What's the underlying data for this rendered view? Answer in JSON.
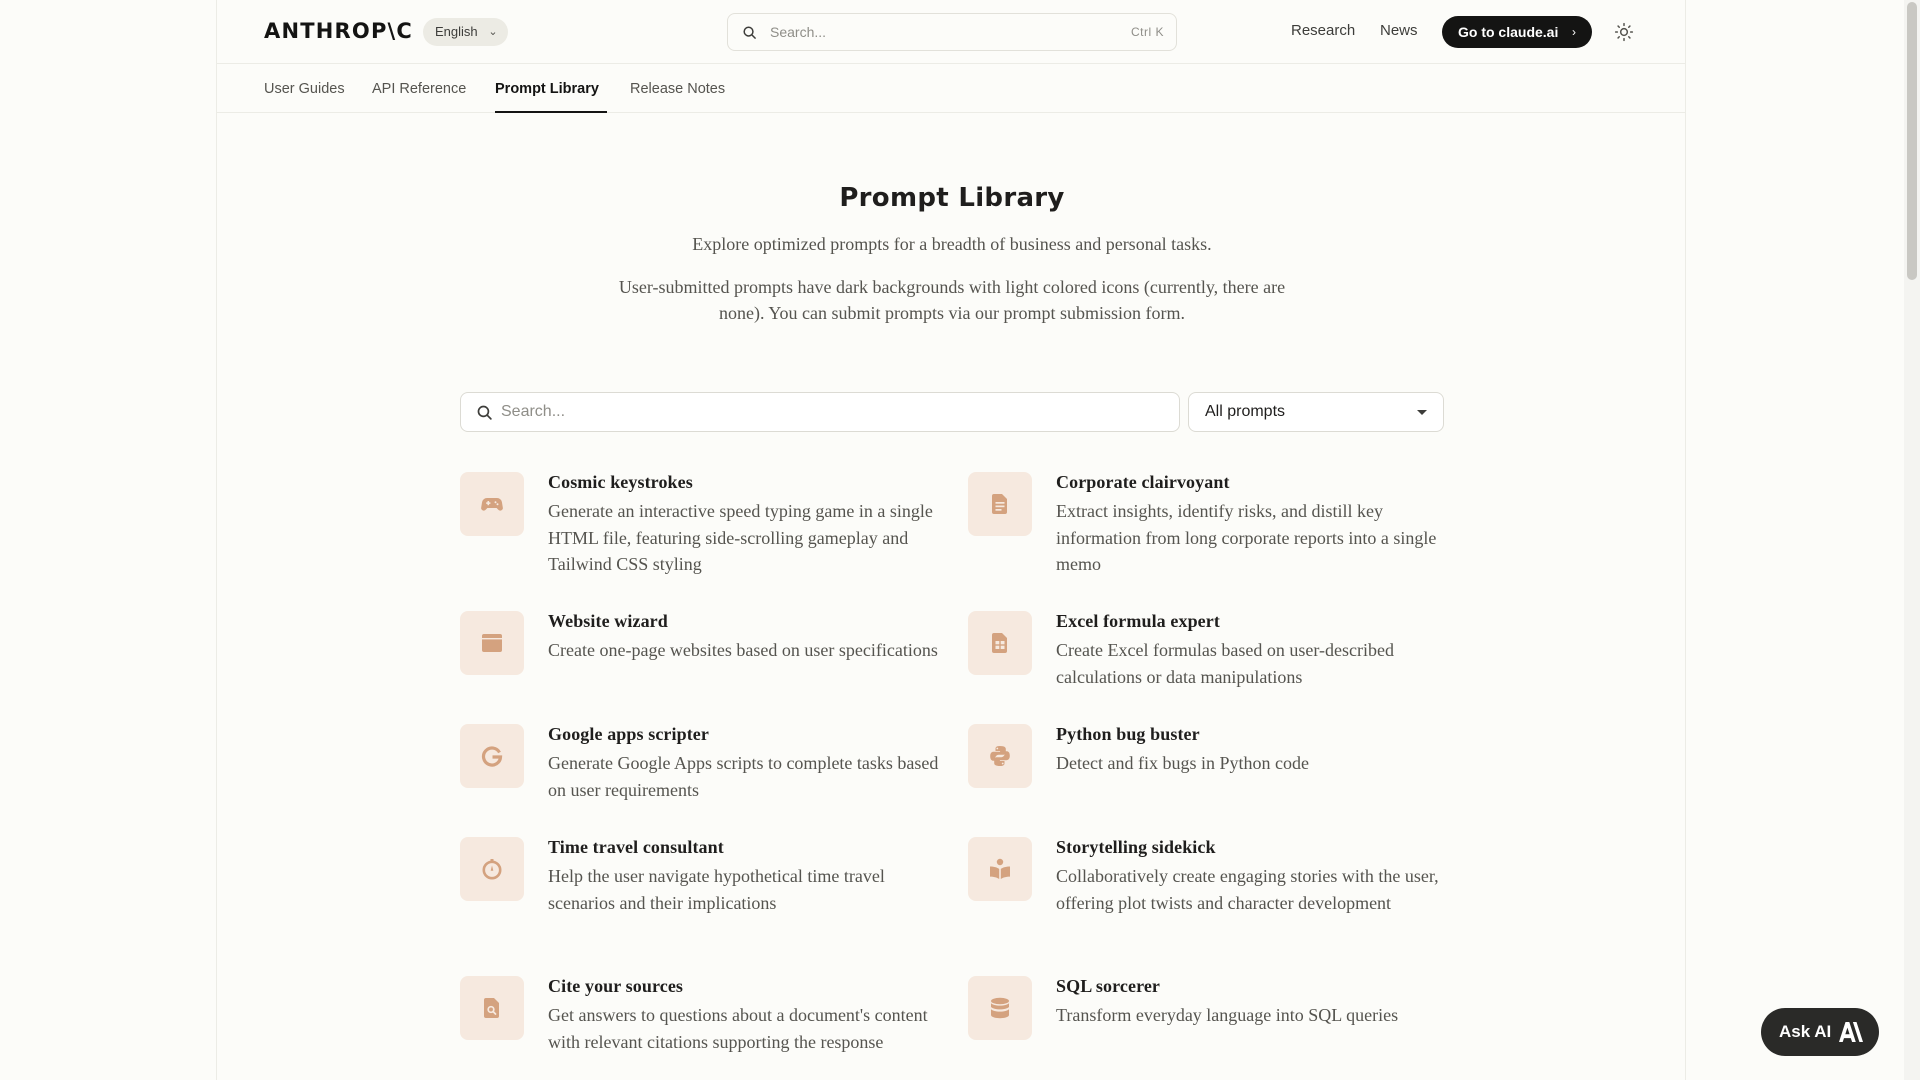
{
  "header": {
    "logo": "ANTHROP\\C",
    "language": "English",
    "search_placeholder": "Search...",
    "search_shortcut": "Ctrl K",
    "nav": [
      "Research",
      "News"
    ],
    "cta_label": "Go to claude.ai"
  },
  "tabs": [
    {
      "label": "User Guides",
      "active": false
    },
    {
      "label": "API Reference",
      "active": false
    },
    {
      "label": "Prompt Library",
      "active": true
    },
    {
      "label": "Release Notes",
      "active": false
    }
  ],
  "hero": {
    "title": "Prompt Library",
    "subtitle": "Explore optimized prompts for a breadth of business and personal tasks.",
    "note_line1": "User-submitted prompts have dark backgrounds with light colored icons (currently, there are",
    "note_line2": "none). You can submit prompts via our prompt submission form."
  },
  "filters": {
    "search_placeholder": "Search...",
    "select_value": "All prompts"
  },
  "cards": [
    {
      "icon": "gamepad-icon",
      "title": "Cosmic keystrokes",
      "desc": "Generate an interactive speed typing game in a single HTML file, featuring side-scrolling gameplay and Tailwind CSS styling"
    },
    {
      "icon": "document-icon",
      "title": "Corporate clairvoyant",
      "desc": "Extract insights, identify risks, and distill key information from long corporate reports into a single memo"
    },
    {
      "icon": "browser-window-icon",
      "title": "Website wizard",
      "desc": "Create one-page websites based on user specifications"
    },
    {
      "icon": "spreadsheet-icon",
      "title": "Excel formula expert",
      "desc": "Create Excel formulas based on user-described calculations or data manipulations"
    },
    {
      "icon": "google-g-icon",
      "title": "Google apps scripter",
      "desc": "Generate Google Apps scripts to complete tasks based on user requirements"
    },
    {
      "icon": "python-icon",
      "title": "Python bug buster",
      "desc": "Detect and fix bugs in Python code"
    },
    {
      "icon": "timer-icon",
      "title": "Time travel consultant",
      "desc": "Help the user navigate hypothetical time travel scenarios and their implications"
    },
    {
      "icon": "book-reader-icon",
      "title": "Storytelling sidekick",
      "desc": "Collaboratively create engaging stories with the user, offering plot twists and character development"
    },
    {
      "icon": "file-search-icon",
      "title": "Cite your sources",
      "desc": "Get answers to questions about a document's content with relevant citations supporting the response"
    },
    {
      "icon": "database-icon",
      "title": "SQL sorcerer",
      "desc": "Transform everyday language into SQL queries"
    }
  ],
  "ask_ai": {
    "label": "Ask AI"
  },
  "colors": {
    "background": "#fcfcf9",
    "icon_tile": "#f6e9df",
    "icon_accent": "#d4a27f",
    "primary_dark": "#141413"
  }
}
